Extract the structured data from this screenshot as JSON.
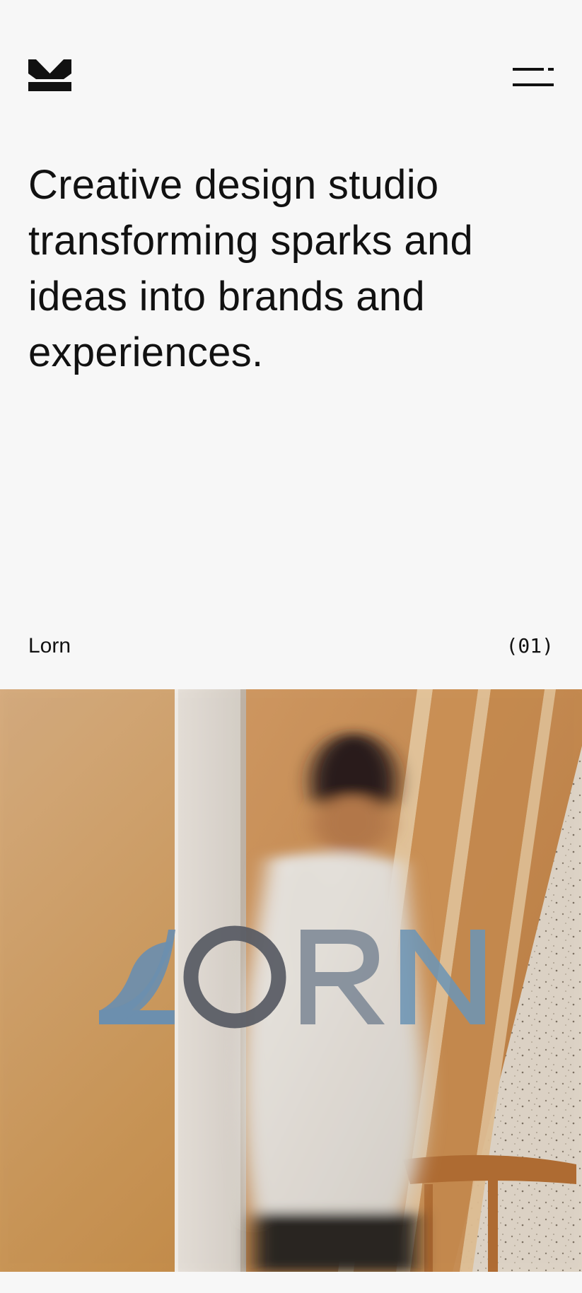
{
  "brand": {
    "logo_icon": "studio-monogram-icon"
  },
  "nav": {
    "menu_icon": "menu-icon"
  },
  "hero": {
    "title": "Creative design studio transforming sparks and ideas into brands and experiences."
  },
  "project": {
    "name": "Lorn",
    "index": "(01)",
    "wordmark": "LORN",
    "image": "photo-person-in-motion-wood-interior"
  },
  "colors": {
    "background": "#f7f7f7",
    "text": "#111111",
    "wordmark_blue": "#6f92b3",
    "wordmark_gray": "#5a5e66"
  }
}
